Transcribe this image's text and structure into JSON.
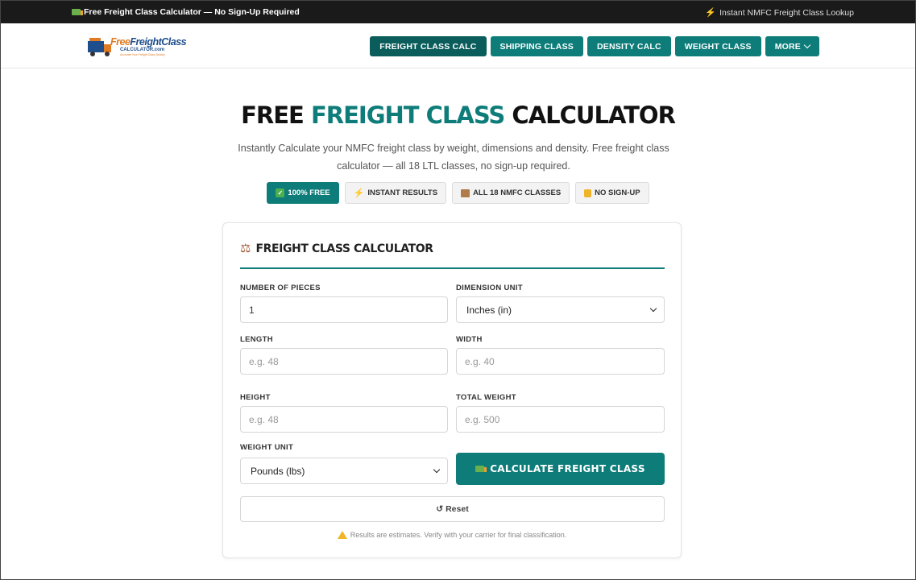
{
  "topbar": {
    "left_text": "Free Freight Class Calculator — No Sign-Up Required",
    "right_text": "Instant NMFC Freight Class Lookup"
  },
  "logo": {
    "line1_a": "Free",
    "line1_b": "FreightClass",
    "line2": "CALCULATOR.com",
    "tagline": "Accurate Your Freight Class Quickly"
  },
  "nav": {
    "items": [
      "FREIGHT CLASS CALC",
      "SHIPPING CLASS",
      "DENSITY CALC",
      "WEIGHT CLASS"
    ],
    "more_label": "MORE"
  },
  "hero": {
    "title_part1": "FREE ",
    "title_part2": "FREIGHT CLASS",
    "title_part3": " CALCULATOR",
    "subtitle": "Instantly Calculate your NMFC freight class by weight, dimensions and density. Free freight class calculator — all 18 LTL classes, no sign-up required."
  },
  "badges": [
    "100% FREE",
    "INSTANT RESULTS",
    "ALL 18 NMFC CLASSES",
    "NO SIGN-UP"
  ],
  "calculator": {
    "title": "FREIGHT CLASS CALCULATOR",
    "pieces_label": "NUMBER OF PIECES",
    "pieces_value": "1",
    "dim_unit_label": "DIMENSION UNIT",
    "dim_unit_value": "Inches (in)",
    "length_label": "LENGTH",
    "length_placeholder": "e.g. 48",
    "width_label": "WIDTH",
    "width_placeholder": "e.g. 40",
    "height_label": "HEIGHT",
    "height_placeholder": "e.g. 48",
    "weight_label": "TOTAL WEIGHT",
    "weight_placeholder": "e.g. 500",
    "weight_unit_label": "WEIGHT UNIT",
    "weight_unit_value": "Pounds (lbs)",
    "calc_button": "CALCULATE FREIGHT CLASS",
    "reset_button": "Reset",
    "note": "Results are estimates. Verify with your carrier for final classification."
  },
  "colors": {
    "accent": "#0e7d7a",
    "accent_dark": "#0a5d5b",
    "topbar": "#1a1a1a"
  }
}
